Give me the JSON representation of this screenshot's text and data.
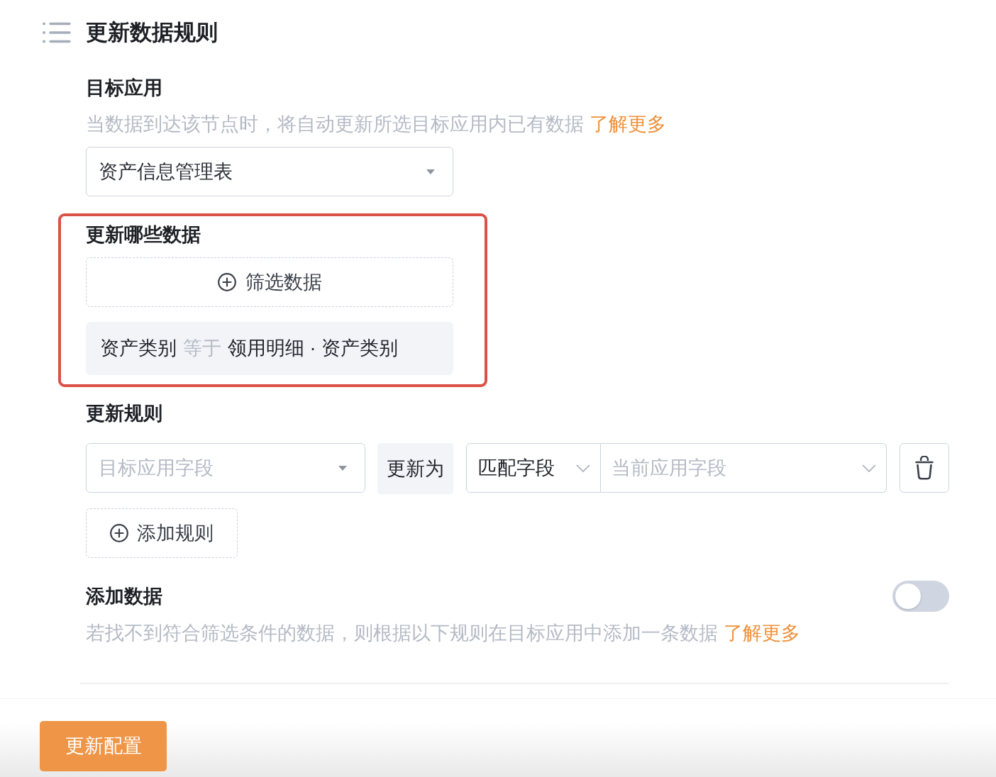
{
  "header": {
    "title": "更新数据规则"
  },
  "target_app": {
    "label": "目标应用",
    "description": "当数据到达该节点时，将自动更新所选目标应用内已有数据",
    "link": "了解更多",
    "select": {
      "value": "资产信息管理表"
    }
  },
  "filter": {
    "label": "更新哪些数据",
    "highlighted": true,
    "add_button": "筛选数据",
    "conditions": [
      {
        "field": "资产类别",
        "operator": "等于",
        "value": "领用明细 · 资产类别"
      }
    ]
  },
  "rules": {
    "label": "更新规则",
    "rows": [
      {
        "target_field": {
          "placeholder": "目标应用字段"
        },
        "action": "更新为",
        "mode": {
          "value": "匹配字段"
        },
        "source_field": {
          "placeholder": "当前应用字段"
        }
      }
    ],
    "add_button": "添加规则"
  },
  "add_data": {
    "label": "添加数据",
    "on": false,
    "description": "若找不到符合筛选条件的数据，则根据以下规则在目标应用中添加一条数据",
    "link": "了解更多"
  },
  "footer": {
    "button": "更新配置"
  }
}
